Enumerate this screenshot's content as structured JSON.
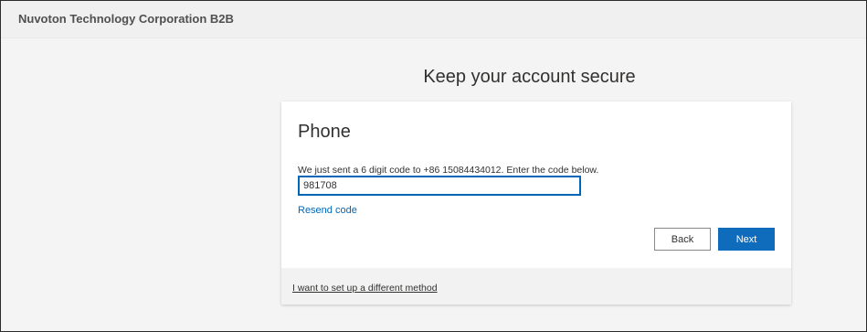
{
  "header": {
    "org_name": "Nuvoton Technology Corporation B2B"
  },
  "page": {
    "title": "Keep your account secure"
  },
  "card": {
    "method_title": "Phone",
    "instruction": "We just sent a 6 digit code to +86 15084434012. Enter the code below.",
    "code_input": {
      "value": "981708"
    },
    "resend_label": "Resend code",
    "back_label": "Back",
    "next_label": "Next",
    "footer_link": "I want to set up a different method"
  },
  "colors": {
    "accent": "#0f6cbd",
    "link": "#0067b8"
  }
}
